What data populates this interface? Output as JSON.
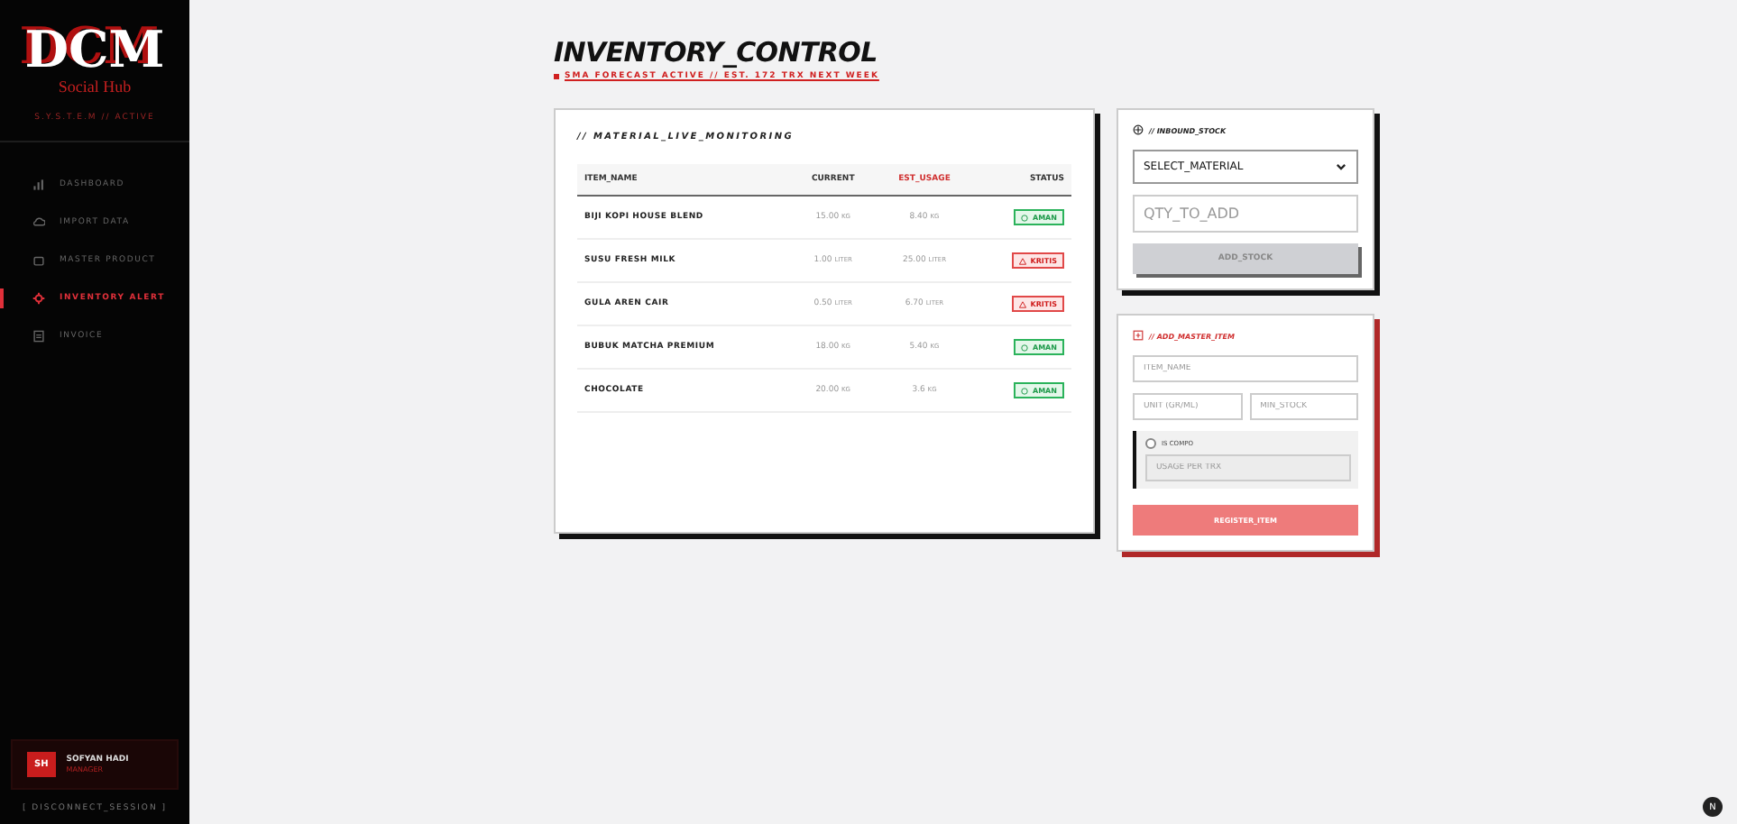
{
  "sidebar": {
    "logo": "DCM",
    "logo_sub": "Social Hub",
    "status": "S.Y.S.T.E.M // ACTIVE",
    "items": [
      {
        "label": "DASHBOARD",
        "selected": false
      },
      {
        "label": "IMPORT DATA",
        "selected": false
      },
      {
        "label": "MASTER PRODUCT",
        "selected": false
      },
      {
        "label": "INVENTORY ALERT",
        "selected": true
      },
      {
        "label": "INVOICE",
        "selected": false
      }
    ],
    "user": {
      "initials": "SH",
      "name": "SOFYAN HADI",
      "role": "MANAGER"
    },
    "logout": "[ DISCONNECT_SESSION ]"
  },
  "header": {
    "title": "INVENTORY_CONTROL",
    "subtitle": "SMA FORECAST ACTIVE // EST. 172 TRX NEXT WEEK"
  },
  "monitor": {
    "title": "// MATERIAL_LIVE_MONITORING",
    "columns": [
      "ITEM_NAME",
      "CURRENT",
      "EST_USAGE",
      "STATUS"
    ],
    "rows": [
      {
        "name": "BIJI KOPI HOUSE BLEND",
        "current": "15.00",
        "current_unit": "KG",
        "usage": "8.40",
        "usage_unit": "KG",
        "status": "AMAN",
        "critical": false
      },
      {
        "name": "SUSU FRESH MILK",
        "current": "1.00",
        "current_unit": "LITER",
        "usage": "25.00",
        "usage_unit": "LITER",
        "status": "KRITIS",
        "critical": true
      },
      {
        "name": "GULA AREN CAIR",
        "current": "0.50",
        "current_unit": "LITER",
        "usage": "6.70",
        "usage_unit": "LITER",
        "status": "KRITIS",
        "critical": true
      },
      {
        "name": "BUBUK MATCHA PREMIUM",
        "current": "18.00",
        "current_unit": "KG",
        "usage": "5.40",
        "usage_unit": "KG",
        "status": "AMAN",
        "critical": false
      },
      {
        "name": "CHOCOLATE",
        "current": "20.00",
        "current_unit": "KG",
        "usage": "3.6",
        "usage_unit": "KG",
        "status": "AMAN",
        "critical": false
      }
    ]
  },
  "inbound": {
    "title": "// INBOUND_STOCK",
    "select": "SELECT_MATERIAL",
    "qty_placeholder": "QTY_TO_ADD",
    "button": "ADD_STOCK"
  },
  "master": {
    "title": "// ADD_MASTER_ITEM",
    "name_placeholder": "ITEM_NAME",
    "unit_placeholder": "UNIT (GR/ML)",
    "min_placeholder": "MIN_STOCK",
    "compo_label": "IS COMPO",
    "compo_checked": false,
    "usage_placeholder": "USAGE PER TRX",
    "button": "REGISTER_ITEM"
  },
  "corner_badge": "N"
}
